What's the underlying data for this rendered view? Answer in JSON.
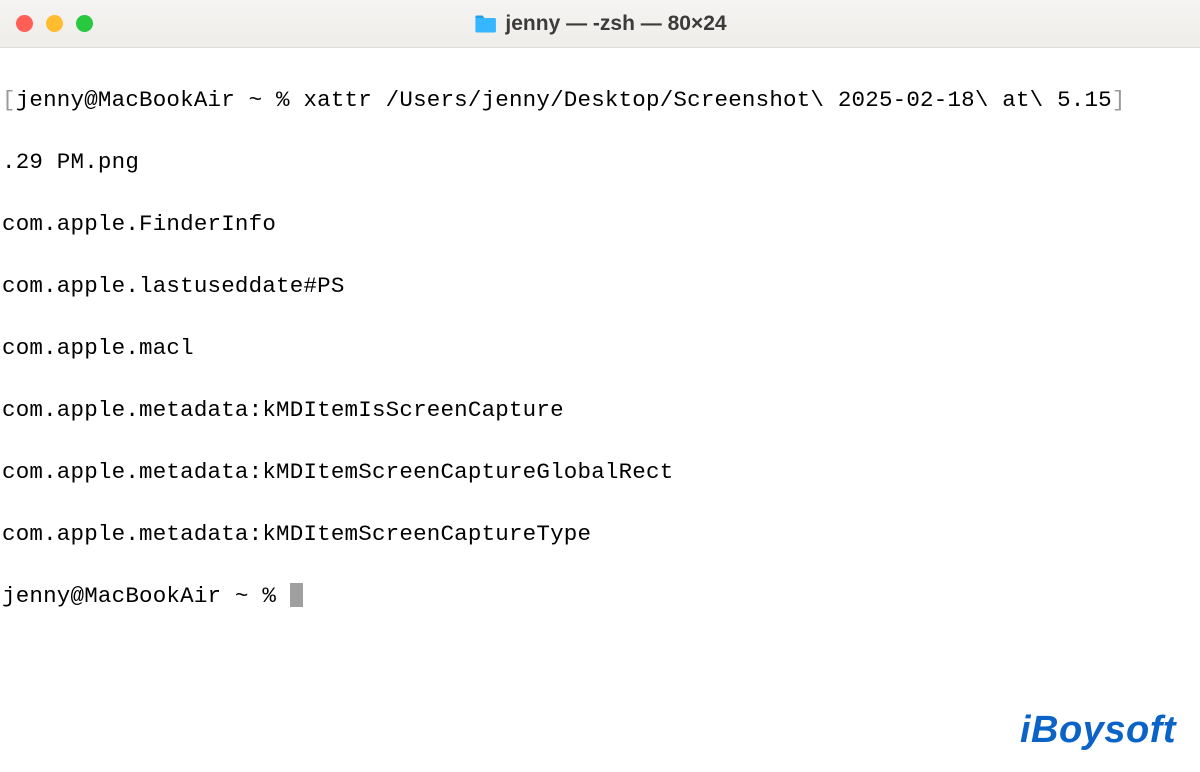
{
  "window": {
    "title": "jenny — -zsh — 80×24"
  },
  "terminal": {
    "line1_open": "[",
    "line1_body": "jenny@MacBookAir ~ % xattr /Users/jenny/Desktop/Screenshot\\ 2025-02-18\\ at\\ 5.15",
    "line1_close": "]",
    "line2": ".29 PM.png",
    "line3": "com.apple.FinderInfo",
    "line4": "com.apple.lastuseddate#PS",
    "line5": "com.apple.macl",
    "line6": "com.apple.metadata:kMDItemIsScreenCapture",
    "line7": "com.apple.metadata:kMDItemScreenCaptureGlobalRect",
    "line8": "com.apple.metadata:kMDItemScreenCaptureType",
    "prompt2": "jenny@MacBookAir ~ % "
  },
  "watermark": {
    "text": "iBoysoft"
  }
}
